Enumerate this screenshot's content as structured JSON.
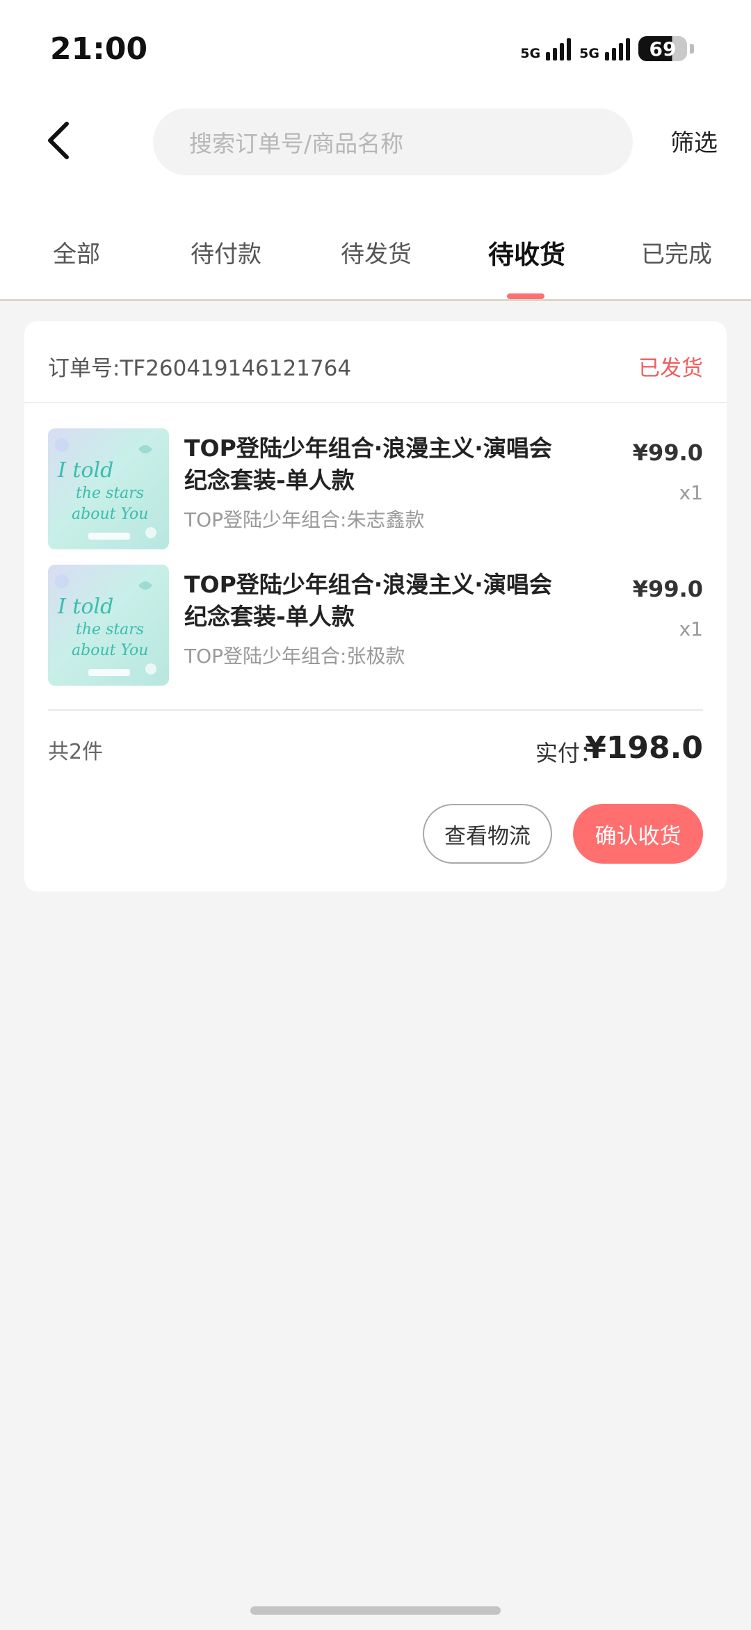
{
  "status_bar": {
    "time": "21:00",
    "network_1": "5G",
    "network_2": "5G",
    "battery": "69"
  },
  "header": {
    "search_placeholder": "搜索订单号/商品名称",
    "filter_label": "筛选"
  },
  "tabs": [
    {
      "label": "全部",
      "active": false
    },
    {
      "label": "待付款",
      "active": false
    },
    {
      "label": "待发货",
      "active": false
    },
    {
      "label": "待收货",
      "active": true
    },
    {
      "label": "已完成",
      "active": false
    }
  ],
  "order": {
    "order_number": "订单号:TF260419146121764",
    "status": "已发货",
    "items": [
      {
        "title": "TOP登陆少年组合·浪漫主义·演唱会纪念套装-单人款",
        "variant": "TOP登陆少年组合:朱志鑫款",
        "price": "¥99.0",
        "quantity": "x1",
        "thumb_text": [
          "I told",
          "the stars",
          "about You"
        ]
      },
      {
        "title": "TOP登陆少年组合·浪漫主义·演唱会纪念套装-单人款",
        "variant": "TOP登陆少年组合:张极款",
        "price": "¥99.0",
        "quantity": "x1",
        "thumb_text": [
          "I told",
          "the stars",
          "about You"
        ]
      }
    ],
    "total_count": "共2件",
    "paid_label": "实付：",
    "paid_amount": "¥198.0",
    "buttons": {
      "logistics": "查看物流",
      "confirm": "确认收货"
    }
  },
  "colors": {
    "accent": "#ff6f6f",
    "status_red": "#f05e5e",
    "background": "#f4f4f4"
  },
  "icons": {
    "back": "chevron-left-icon"
  }
}
